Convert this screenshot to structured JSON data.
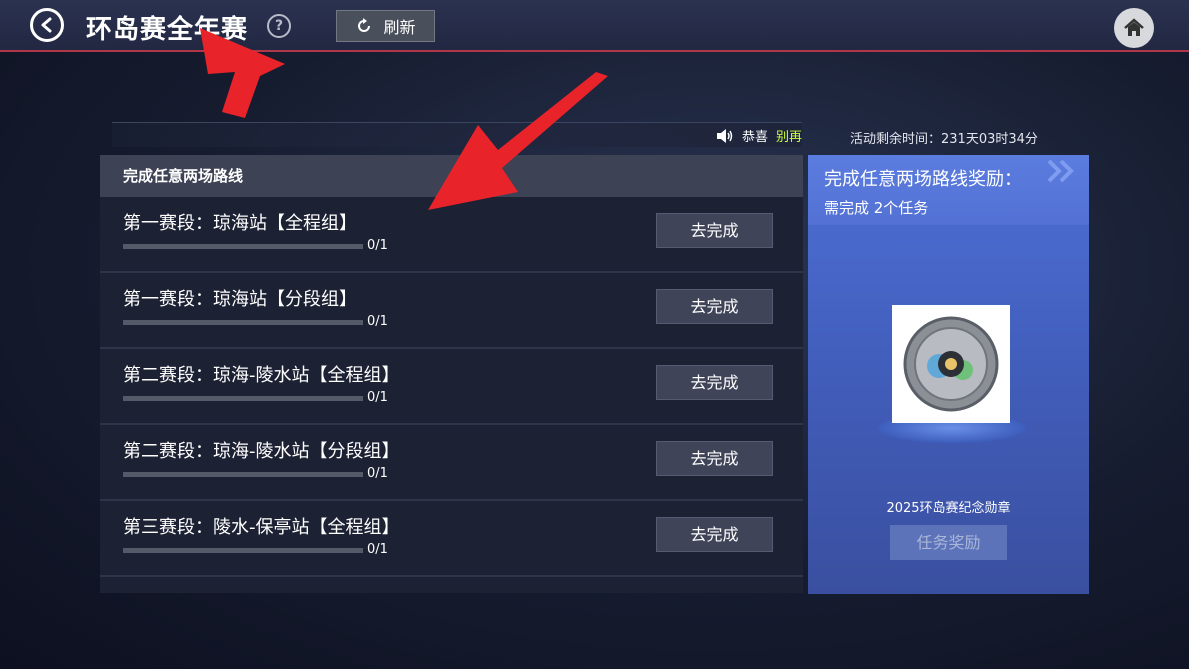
{
  "header": {
    "title": "环岛赛全年赛",
    "help_label": "?",
    "refresh_label": "刷新"
  },
  "ticker": {
    "prefix": "恭喜",
    "highlight": "别再"
  },
  "countdown": "活动剩余时间：231天03时34分",
  "panel": {
    "header": "完成任意两场路线",
    "tasks": [
      {
        "name": "第一赛段：琼海站【全程组】",
        "progress": "0/1",
        "progress_fraction": 0,
        "button": "去完成"
      },
      {
        "name": "第一赛段：琼海站【分段组】",
        "progress": "0/1",
        "progress_fraction": 0,
        "button": "去完成"
      },
      {
        "name": "第二赛段：琼海-陵水站【全程组】",
        "progress": "0/1",
        "progress_fraction": 0,
        "button": "去完成"
      },
      {
        "name": "第二赛段：琼海-陵水站【分段组】",
        "progress": "0/1",
        "progress_fraction": 0,
        "button": "去完成"
      },
      {
        "name": "第三赛段：陵水-保亭站【全程组】",
        "progress": "0/1",
        "progress_fraction": 0,
        "button": "去完成"
      }
    ]
  },
  "reward": {
    "title": "完成任意两场路线奖励：",
    "subtitle": "需完成 2个任务",
    "medal_name": "2025环岛赛纪念勋章",
    "button": "任务奖励"
  },
  "icons": {
    "back": "back-arrow-icon",
    "help": "question-icon",
    "refresh": "refresh-icon",
    "home": "home-icon",
    "speaker": "speaker-icon",
    "medal": "medal-icon"
  },
  "colors": {
    "accent_red": "#b0364a",
    "ticker_highlight": "#c9ff3a",
    "reward_panel": "#4d6fd6",
    "annotation_arrow": "#e8242a"
  }
}
